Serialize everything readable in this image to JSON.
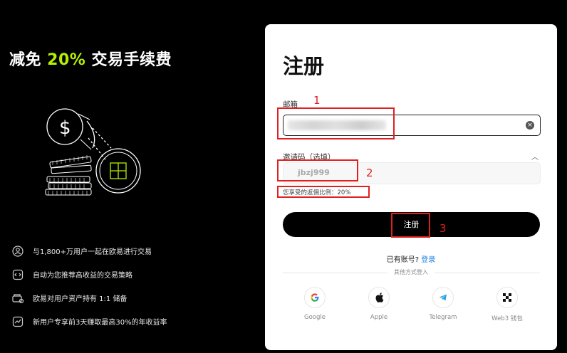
{
  "promo": {
    "headline_prefix": "减免 ",
    "headline_accent": "20%",
    "headline_suffix": " 交易手续费",
    "features": [
      {
        "icon": "users-icon",
        "text": "与1,800+万用户一起在欧易进行交易"
      },
      {
        "icon": "strategy-icon",
        "text": "自动为您推荐高收益的交易策略"
      },
      {
        "icon": "reserve-icon",
        "text": "欧易对用户资产持有 1:1 储备"
      },
      {
        "icon": "yield-icon",
        "text": "新用户专享前3天赚取最高30%的年收益率"
      }
    ]
  },
  "form": {
    "title": "注册",
    "email_label": "邮箱",
    "invite_label": "邀请码（选填）",
    "invite_value": "jbzj999",
    "rebate_text": "您享受的返佣比例：20%",
    "submit_label": "注册",
    "have_account": "已有账号? ",
    "login_link": "登录",
    "other_methods": "其他方式登入",
    "social": [
      {
        "name": "Google",
        "icon": "google-icon"
      },
      {
        "name": "Apple",
        "icon": "apple-icon"
      },
      {
        "name": "Telegram",
        "icon": "telegram-icon"
      },
      {
        "name": "Web3 钱包",
        "icon": "web3-wallet-icon"
      }
    ]
  },
  "annotations": [
    "1",
    "2",
    "3"
  ],
  "colors": {
    "accent": "#b4f000",
    "link": "#1a7fe0",
    "annotation": "#e02020"
  }
}
